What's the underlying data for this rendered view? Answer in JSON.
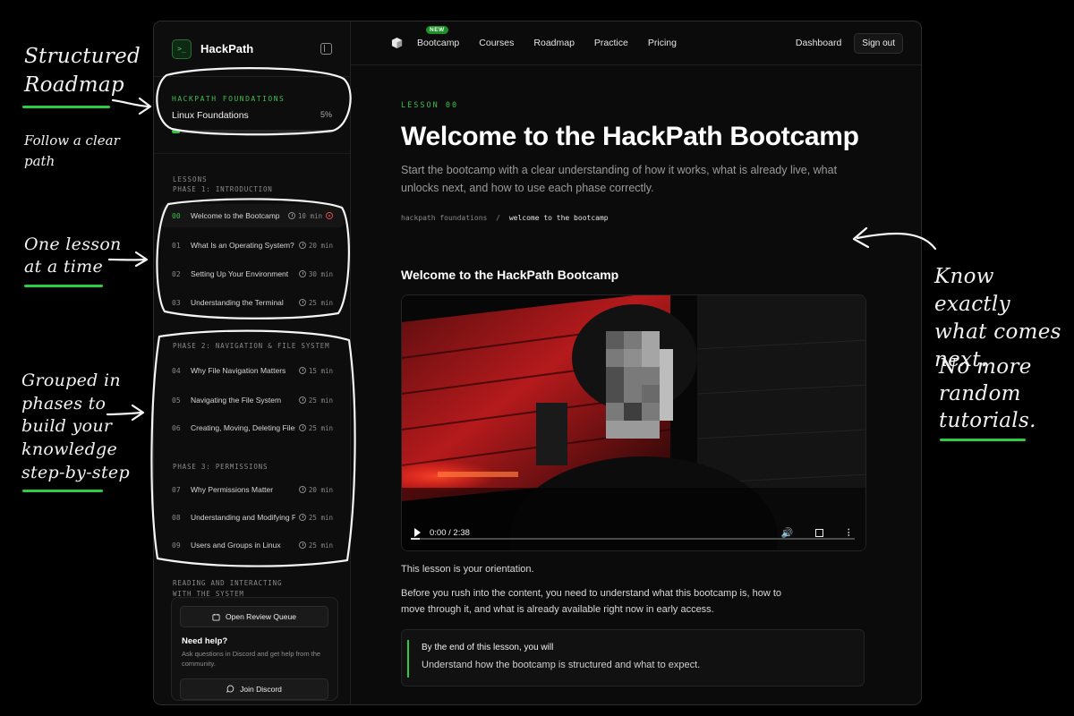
{
  "annotations": {
    "roadmap": [
      "Structured",
      "Roadmap"
    ],
    "follow": [
      "Follow a clear",
      "path"
    ],
    "one_lesson": [
      "One lesson",
      "at a time"
    ],
    "grouped": [
      "Grouped in",
      "phases to",
      "build your",
      "knowledge",
      "step-by-step"
    ],
    "know": [
      "Know exactly",
      "what comes",
      "next."
    ],
    "no_more": [
      "No more",
      "random",
      "tutorials."
    ]
  },
  "brand": {
    "name": "HackPath",
    "logo_glyph": ">_",
    "logo_icon": "terminal-icon"
  },
  "course": {
    "kicker": "HACKPATH FOUNDATIONS",
    "name": "Linux Foundations",
    "percent_label": "5%",
    "progress": 0.05
  },
  "sidebar": {
    "lessons_heading": "LESSONS",
    "phases": [
      {
        "label": "PHASE 1: INTRODUCTION"
      },
      {
        "label": "PHASE 2: NAVIGATION & FILE SYSTEM"
      },
      {
        "label": "PHASE 3: PERMISSIONS"
      },
      {
        "label": "READING AND INTERACTING WITH THE SYSTEM"
      }
    ],
    "lessons": [
      {
        "num": "00",
        "title": "Welcome to the Bootcamp",
        "dur": "10 min"
      },
      {
        "num": "01",
        "title": "What Is an Operating System?",
        "dur": "20 min"
      },
      {
        "num": "02",
        "title": "Setting Up Your Environment",
        "dur": "30 min"
      },
      {
        "num": "03",
        "title": "Understanding the Terminal",
        "dur": "25 min"
      },
      {
        "num": "04",
        "title": "Why File Navigation Matters",
        "dur": "15 min"
      },
      {
        "num": "05",
        "title": "Navigating the File System",
        "dur": "25 min"
      },
      {
        "num": "06",
        "title": "Creating, Moving, Deleting Files",
        "dur": "25 min"
      },
      {
        "num": "07",
        "title": "Why Permissions Matter",
        "dur": "20 min"
      },
      {
        "num": "08",
        "title": "Understanding and Modifying Permissions",
        "dur": "25 min"
      },
      {
        "num": "09",
        "title": "Users and Groups in Linux",
        "dur": "25 min"
      }
    ],
    "review_button": "Open Review Queue",
    "help_title": "Need help?",
    "help_text": "Ask questions in Discord and get help from the community.",
    "discord_button": "Join Discord"
  },
  "nav": {
    "items": [
      "Bootcamp",
      "Courses",
      "Roadmap",
      "Practice",
      "Pricing"
    ],
    "new_badge": "NEW",
    "dashboard": "Dashboard",
    "signout": "Sign out"
  },
  "lesson": {
    "label": "LESSON 00",
    "title": "Welcome to the HackPath Bootcamp",
    "subtitle": "Start the bootcamp with a clear understanding of how it works, what is already live, what unlocks next, and how to use each phase correctly.",
    "crumb_parent": "hackpath foundations",
    "crumb_sep": "/",
    "crumb_current": "welcome to the bootcamp",
    "video_heading": "Welcome to the HackPath Bootcamp",
    "video_time": "0:00 / 2:38",
    "video_progress": 0.02,
    "para1": "This lesson is your orientation.",
    "para2": "Before you rush into the content, you need to understand what this bootcamp is, how to move through it, and what is already available right now in early access.",
    "outcome_title": "By the end of this lesson, you will",
    "outcome_text": "Understand how the bootcamp is structured and what to expect."
  },
  "colors": {
    "accent": "#2ecc3f",
    "background": "#000000",
    "panel": "#0d0d0d"
  }
}
